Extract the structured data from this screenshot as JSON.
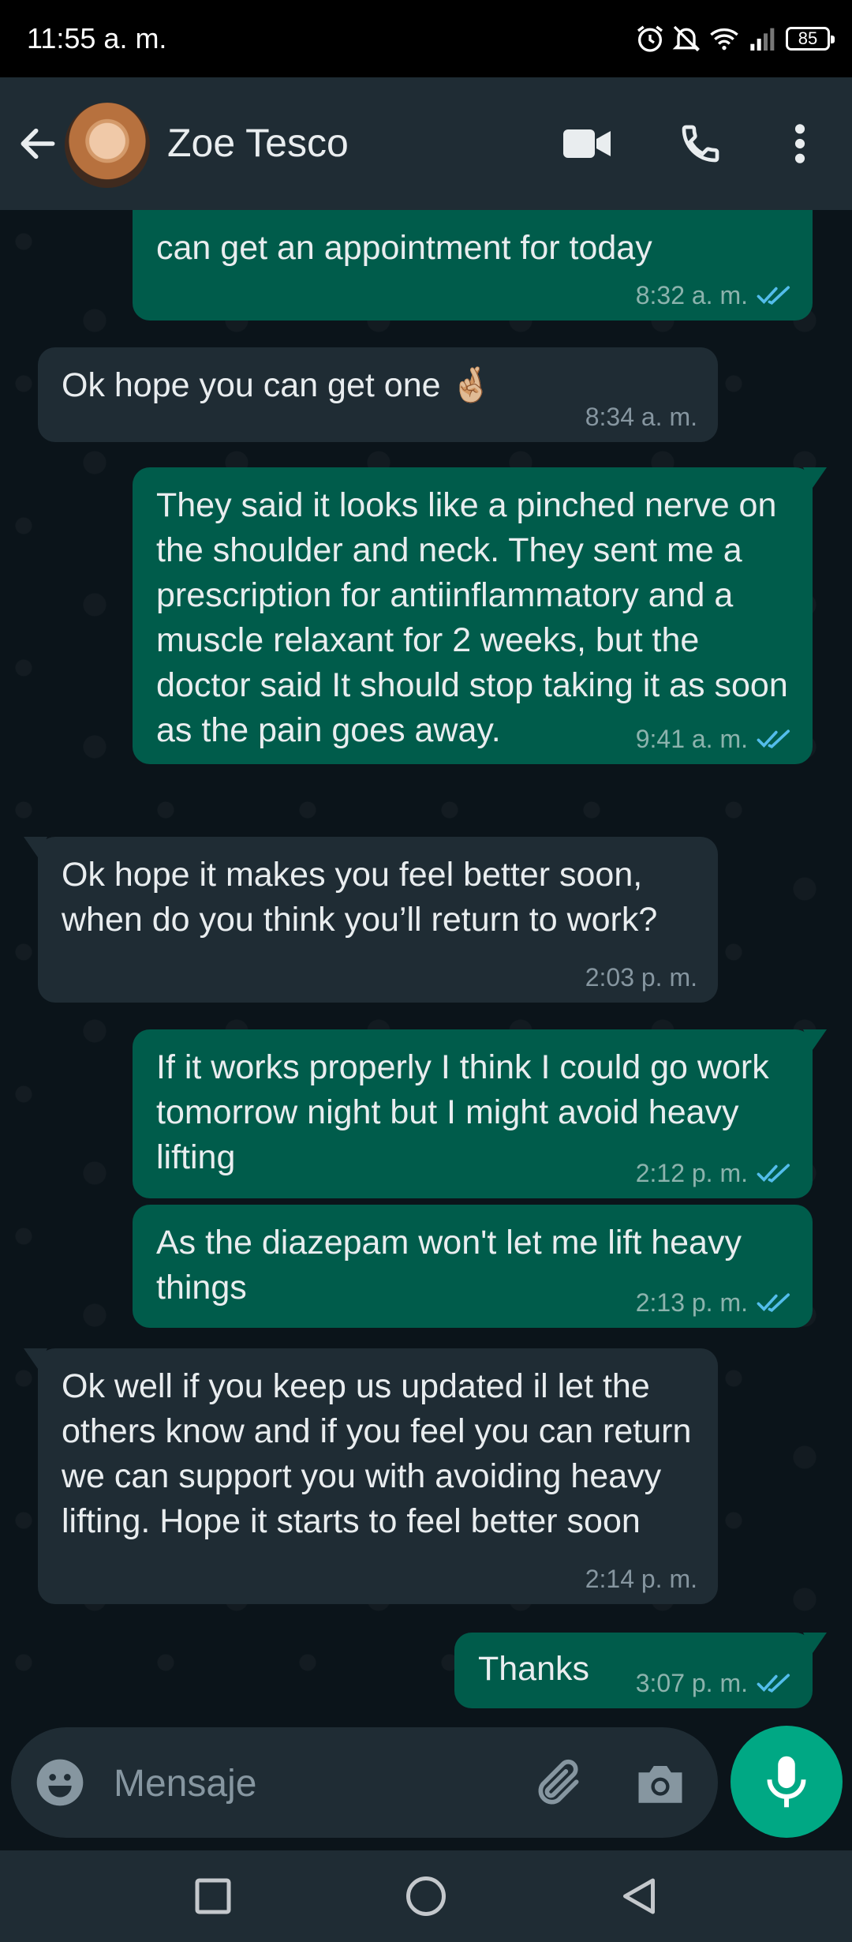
{
  "status_bar": {
    "time": "11:55 a. m.",
    "battery": "85"
  },
  "header": {
    "contact_name": "Zoe Tesco"
  },
  "messages": [
    {
      "direction": "out",
      "text": "can get an appointment for today",
      "time": "8:32 a. m.",
      "status": "read"
    },
    {
      "direction": "in",
      "text": "Ok hope you can get one 🤞🏼",
      "time": "8:34 a. m."
    },
    {
      "direction": "out",
      "text": "They said it looks like a pinched nerve on the shoulder and neck. They sent me a prescription for antiinflammatory and a muscle relaxant for 2 weeks, but the doctor said It should stop taking it as soon as the pain goes away.",
      "time": "9:41 a. m.",
      "status": "read"
    },
    {
      "direction": "in",
      "text": "Ok hope it makes you feel better soon, when do you think you’ll return to work?",
      "time": "2:03 p. m."
    },
    {
      "direction": "out",
      "text": "If it works properly I think I could go work tomorrow night but I might avoid heavy lifting",
      "time": "2:12 p. m.",
      "status": "read"
    },
    {
      "direction": "out",
      "text": "As the diazepam won't let me lift heavy things",
      "time": "2:13 p. m.",
      "status": "read"
    },
    {
      "direction": "in",
      "text": "Ok well if you keep us updated il let the others know and if you feel you can return we can support you with avoiding heavy lifting. Hope it starts to feel better soon",
      "time": "2:14 p. m."
    },
    {
      "direction": "out",
      "text": "Thanks",
      "time": "3:07 p. m.",
      "status": "read"
    }
  ],
  "composer": {
    "placeholder": "Mensaje"
  },
  "colors": {
    "outgoing": "#005c4b",
    "incoming": "#1f2c34",
    "accent": "#00a884",
    "read_ticks": "#53bdeb"
  },
  "icons": {
    "back": "arrow-left-icon",
    "video": "video-camera-icon",
    "call": "phone-icon",
    "menu": "more-vert-icon",
    "emoji": "emoji-icon",
    "attach": "paperclip-icon",
    "camera": "camera-icon",
    "mic": "microphone-icon"
  }
}
